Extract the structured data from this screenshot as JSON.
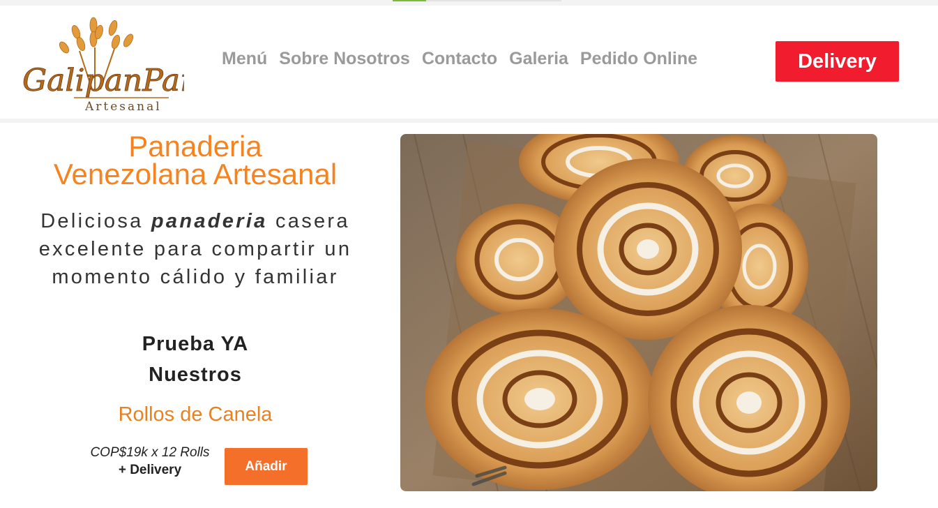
{
  "header": {
    "progress": 0.2,
    "logo": {
      "script": "GalipanPan",
      "sub": "Artesanal"
    },
    "nav": [
      "Menú",
      "Sobre Nosotros",
      "Contacto",
      "Galeria",
      "Pedido Online"
    ],
    "delivery_label": "Delivery"
  },
  "hero": {
    "title_line1": "Panaderia",
    "title_line2": "Venezolana Artesanal",
    "desc_pre": "Deliciosa ",
    "desc_em": "panaderia",
    "desc_line1_post": " casera",
    "desc_line2": "excelente para compartir un",
    "desc_line3": "momento cálido y familiar",
    "prueba_line1": "Prueba YA",
    "prueba_line2": "Nuestros",
    "product": "Rollos de Canela",
    "price_line1": "COP$19k x 12 Rolls",
    "price_line2": "+ Delivery",
    "add_label": "Añadir",
    "image_alt": "cinnamon-rolls-photo"
  },
  "colors": {
    "accent_orange": "#f5831f",
    "button_orange": "#f4702a",
    "delivery_red": "#f11c2d",
    "nav_gray": "#9a9a9a"
  }
}
